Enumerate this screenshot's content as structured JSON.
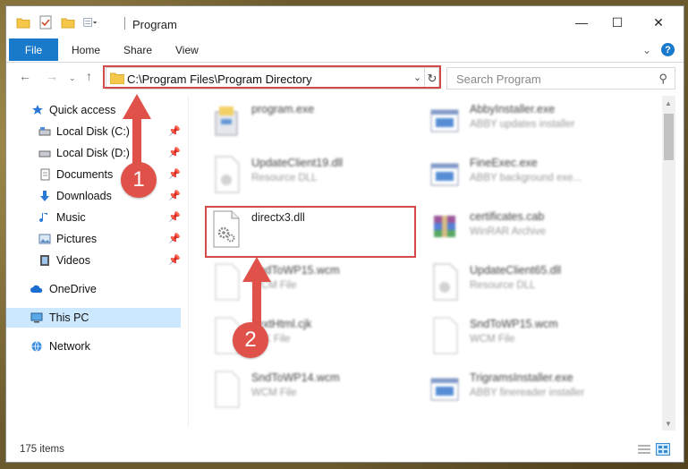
{
  "window": {
    "title": "Program",
    "controls": [
      "minimize",
      "maximize",
      "close"
    ]
  },
  "ribbon": {
    "tabs": [
      "File",
      "Home",
      "Share",
      "View"
    ],
    "help": "?"
  },
  "address": {
    "path": "C:\\Program Files\\Program Directory",
    "search_placeholder": "Search Program"
  },
  "nav_pane": {
    "items": [
      {
        "label": "Quick access",
        "icon": "star-icon"
      },
      {
        "label": "Local Disk (C:)",
        "icon": "drive-icon",
        "pinned": true
      },
      {
        "label": "Local Disk (D:)",
        "icon": "drive-icon",
        "pinned": true
      },
      {
        "label": "Documents",
        "icon": "documents-icon",
        "pinned": true
      },
      {
        "label": "Downloads",
        "icon": "download-icon",
        "pinned": true
      },
      {
        "label": "Music",
        "icon": "music-icon",
        "pinned": true
      },
      {
        "label": "Pictures",
        "icon": "pictures-icon",
        "pinned": true
      },
      {
        "label": "Videos",
        "icon": "videos-icon",
        "pinned": true
      },
      {
        "label": "OneDrive",
        "icon": "cloud-icon"
      },
      {
        "label": "This PC",
        "icon": "computer-icon",
        "selected": true
      },
      {
        "label": "Network",
        "icon": "network-icon"
      }
    ]
  },
  "files": [
    {
      "name": "program.exe",
      "desc": "",
      "icon": "exe-installer-icon"
    },
    {
      "name": "AbbyInstaller.exe",
      "desc": "ABBY updates installer",
      "icon": "app-window-icon"
    },
    {
      "name": "UpdateClient19.dll",
      "desc": "Resource DLL",
      "icon": "dll-icon"
    },
    {
      "name": "FineExec.exe",
      "desc": "ABBY background exe...",
      "icon": "app-window-icon"
    },
    {
      "name": "directx3.dll",
      "desc": "",
      "icon": "dll-gear-icon"
    },
    {
      "name": "certificates.cab",
      "desc": "WinRAR Archive",
      "icon": "archive-icon"
    },
    {
      "name": "SndToWP15.wcm",
      "desc": "WCM File",
      "icon": "blank-file-icon"
    },
    {
      "name": "UpdateClient65.dll",
      "desc": "Resource DLL",
      "icon": "dll-icon"
    },
    {
      "name": "TextHtml.cjk",
      "desc": "CJK File",
      "icon": "blank-file-icon"
    },
    {
      "name": "SndToWP15.wcm",
      "desc": "WCM File",
      "icon": "blank-file-icon"
    },
    {
      "name": "SndToWP14.wcm",
      "desc": "WCM File",
      "icon": "blank-file-icon"
    },
    {
      "name": "TrigramsInstaller.exe",
      "desc": "ABBY finereader installer",
      "icon": "app-window-icon"
    }
  ],
  "status": {
    "item_count": "175 items"
  },
  "annotations": {
    "step1": "1",
    "step2": "2",
    "highlight_color": "#d34a4a",
    "marker_color": "#e0514a"
  }
}
